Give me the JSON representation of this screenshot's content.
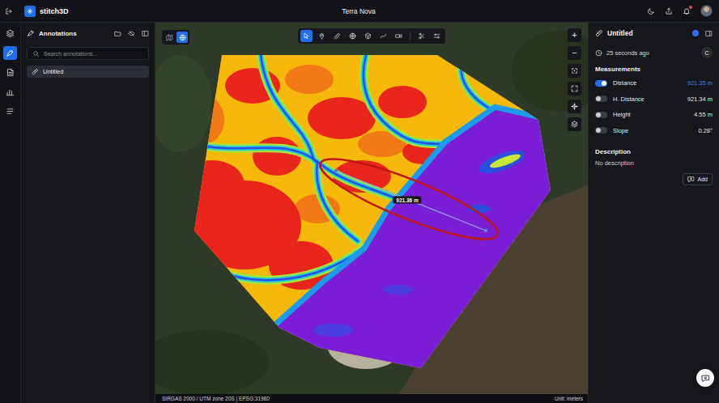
{
  "topbar": {
    "app_name": "stitch3D",
    "project": "Terra Nova",
    "notification_unread": true
  },
  "rail": [
    {
      "selected": false
    },
    {
      "selected": true
    },
    {
      "selected": false
    },
    {
      "selected": false
    },
    {
      "selected": false
    }
  ],
  "annotations_panel": {
    "title": "Annotations",
    "search": {
      "placeholder": "Search annotations..."
    },
    "items": [
      {
        "label": "Untitled",
        "selected": true
      }
    ]
  },
  "map": {
    "view_modes": [
      {
        "selected": false
      },
      {
        "selected": true
      }
    ],
    "tools": [
      {
        "selected": true
      },
      {
        "selected": false
      },
      {
        "selected": false
      },
      {
        "selected": false
      },
      {
        "selected": false
      },
      {
        "selected": false
      },
      {
        "selected": false
      },
      {
        "selected": false
      },
      {
        "selected": false
      }
    ],
    "zoom": [
      "+",
      "−"
    ],
    "measurement_label": "921.36 m"
  },
  "details": {
    "title": "Untitled",
    "color": "#2f6fed",
    "time": "25 seconds ago",
    "user_initial": "C",
    "measurements_title": "Measurements",
    "measurements": [
      {
        "label": "Distance",
        "value": "921.35 m",
        "on": true
      },
      {
        "label": "H. Distance",
        "value": "921.34 m",
        "on": false
      },
      {
        "label": "Height",
        "value": "4.55 m",
        "on": false
      },
      {
        "label": "Slope",
        "value": "0.28°",
        "on": false
      }
    ],
    "description_title": "Description",
    "description": "No description",
    "add_button": "Add"
  },
  "status_bar": {
    "crs": "SIRGAS 2000 / UTM zone 20S | EPSG:31980",
    "unit": "Unit: meters"
  }
}
